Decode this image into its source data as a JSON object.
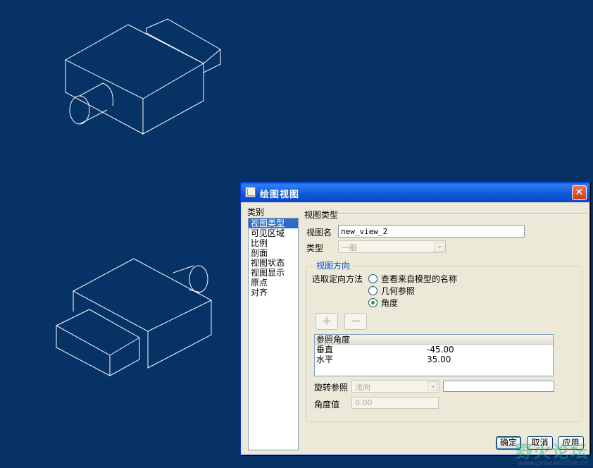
{
  "dialog": {
    "title": "绘图视图",
    "close_glyph": "✕",
    "category_label": "类别",
    "categories": [
      {
        "label": "视图类型",
        "selected": true
      },
      {
        "label": "可见区域",
        "selected": false
      },
      {
        "label": "比例",
        "selected": false
      },
      {
        "label": "剖面",
        "selected": false
      },
      {
        "label": "视图状态",
        "selected": false
      },
      {
        "label": "视图显示",
        "selected": false
      },
      {
        "label": "原点",
        "selected": false
      },
      {
        "label": "对齐",
        "selected": false
      }
    ],
    "section_title": "视图类型",
    "view_name_label": "视图名",
    "view_name_value": "new_view_2",
    "type_label": "类型",
    "type_value": "一般",
    "orientation_group_title": "视图方向",
    "orientation_method_label": "选取定向方法",
    "orientation_options": [
      {
        "label": "查看来自模型的名称",
        "selected": false
      },
      {
        "label": "几何参照",
        "selected": false
      },
      {
        "label": "角度",
        "selected": true
      }
    ],
    "add_glyph": "+",
    "remove_glyph": "−",
    "table": {
      "header": "参照角度",
      "rows": [
        {
          "name": "垂直",
          "value": "-45.00"
        },
        {
          "name": "水平",
          "value": "35.00"
        }
      ]
    },
    "rotation_ref_label": "旋转参照",
    "rotation_ref_value": "法向",
    "angle_value_label": "角度值",
    "angle_value": "0.00",
    "buttons": {
      "ok": "确定",
      "cancel": "取消",
      "apply": "应用"
    }
  },
  "watermark": {
    "text": "野火论坛",
    "url": "www.proewildfire.cn"
  },
  "colors": {
    "background": "#063266",
    "titlebar": "#0a5fe0",
    "selection": "#316ac5",
    "model_lines": "#ffffff"
  }
}
